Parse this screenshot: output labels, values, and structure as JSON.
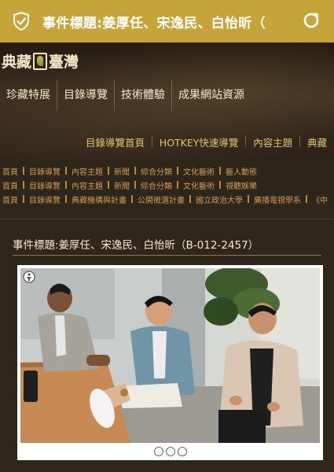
{
  "browser": {
    "title": "事件標題:姜厚任、宋逸民、白怡昕（",
    "icons": [
      "shield-check-icon",
      "reload-icon"
    ],
    "color": "#c6a43a"
  },
  "site": {
    "logo_left": "典藏",
    "logo_right": "臺灣"
  },
  "main_nav": [
    "珍藏特展",
    "目錄導覽",
    "技術體驗",
    "成果網站資源"
  ],
  "sub_nav": [
    "目錄導覽首頁",
    "HOTKEY快速導覽",
    "內容主題",
    "典藏"
  ],
  "category_rows": [
    [
      "首頁",
      "目錄導覽",
      "內容主題",
      "新聞",
      "綜合分類",
      "文化藝術",
      "藝人動態"
    ],
    [
      "首頁",
      "目錄導覽",
      "內容主題",
      "新聞",
      "綜合分類",
      "文化藝術",
      "視聽娛樂"
    ],
    [
      "首頁",
      "目錄導覽",
      "典藏機構與計畫",
      "公開徵選計畫",
      "國立政治大學",
      "廣播電視學系",
      "《中"
    ]
  ],
  "event": {
    "title": "事件標題:姜厚任、宋逸民、白怡昕（B-012-2457）"
  },
  "photo": {
    "icons": [
      "creative-commons-icon",
      "attribution-icon",
      "noncommercial-icon",
      "no-derivatives-icon"
    ]
  }
}
